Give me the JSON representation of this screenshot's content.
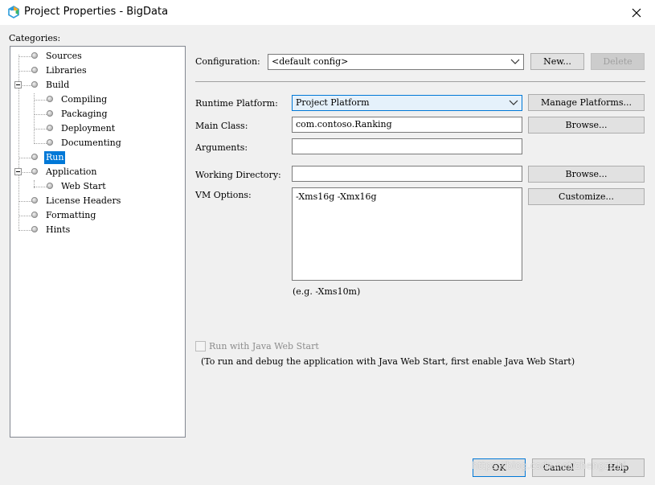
{
  "window": {
    "title": "Project Properties - BigData",
    "close_icon": "close-icon",
    "app_icon": "hexagon-app-icon"
  },
  "categories": {
    "label": "Categories:",
    "items": [
      {
        "label": "Sources"
      },
      {
        "label": "Libraries"
      },
      {
        "label": "Build"
      },
      {
        "label": "Compiling"
      },
      {
        "label": "Packaging"
      },
      {
        "label": "Deployment"
      },
      {
        "label": "Documenting"
      },
      {
        "label": "Run",
        "selected": true
      },
      {
        "label": "Application"
      },
      {
        "label": "Web Start"
      },
      {
        "label": "License Headers"
      },
      {
        "label": "Formatting"
      },
      {
        "label": "Hints"
      }
    ]
  },
  "configuration": {
    "label": "Configuration:",
    "value": "<default config>",
    "new_label": "New...",
    "delete_label": "Delete"
  },
  "run": {
    "runtime_platform_label": "Runtime Platform:",
    "runtime_platform_value": "Project Platform",
    "manage_platforms_label": "Manage Platforms...",
    "main_class_label": "Main Class:",
    "main_class_value": "com.contoso.Ranking",
    "browse_label": "Browse...",
    "arguments_label": "Arguments:",
    "arguments_value": "",
    "working_dir_label": "Working Directory:",
    "working_dir_value": "",
    "working_dir_browse_label": "Browse...",
    "vm_options_label": "VM Options:",
    "vm_options_value": "-Xms16g -Xmx16g",
    "customize_label": "Customize...",
    "vm_hint": "(e.g. -Xms10m)",
    "web_start_checkbox_label": "Run with Java Web Start",
    "web_start_note": "(To run and debug the application with Java Web Start, first enable Java Web Start)"
  },
  "footer": {
    "ok_label": "OK",
    "cancel_label": "Cancel",
    "help_label": "Help",
    "watermark": "https://blog.csdn.net/zhengzizhi"
  },
  "colors": {
    "selection": "#0078d7",
    "dialog_bg": "#f0f0f0",
    "button_bg": "#e1e1e1"
  }
}
